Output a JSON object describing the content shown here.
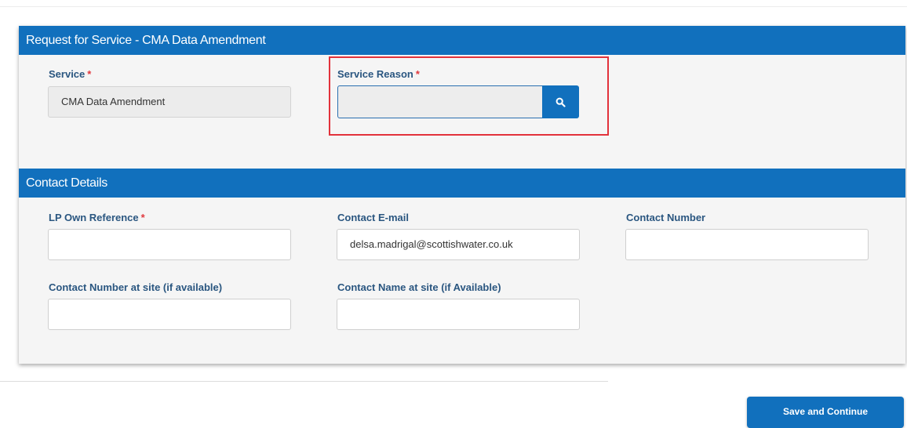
{
  "service_section": {
    "title": "Request for Service - CMA Data Amendment",
    "service_label": "Service",
    "service_value": "CMA Data Amendment",
    "service_reason_label": "Service Reason",
    "service_reason_value": "",
    "required_marker": "*"
  },
  "contact_section": {
    "title": "Contact Details",
    "lp_own_reference_label": "LP Own Reference",
    "lp_own_reference_value": "",
    "contact_email_label": "Contact E-mail",
    "contact_email_value": "delsa.madrigal@scottishwater.co.uk",
    "contact_number_label": "Contact Number",
    "contact_number_value": "",
    "contact_number_site_label": "Contact Number at site (if available)",
    "contact_number_site_value": "",
    "contact_name_site_label": "Contact Name at site (if Available)",
    "contact_name_site_value": ""
  },
  "actions": {
    "save_continue_label": "Save and Continue"
  },
  "icons": {
    "search": "search-icon"
  },
  "colors": {
    "primary": "#1170bd",
    "label": "#2a5680",
    "required": "#e0393e",
    "highlight": "#e2323b"
  }
}
